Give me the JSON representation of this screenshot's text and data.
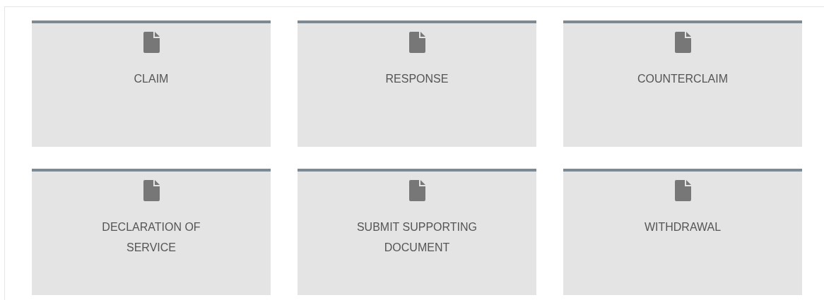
{
  "tiles": [
    {
      "label": "CLAIM"
    },
    {
      "label": "RESPONSE"
    },
    {
      "label": "COUNTERCLAIM"
    },
    {
      "label": "DECLARATION OF SERVICE"
    },
    {
      "label": "SUBMIT SUPPORTING DOCUMENT"
    },
    {
      "label": "WITHDRAWAL"
    }
  ]
}
